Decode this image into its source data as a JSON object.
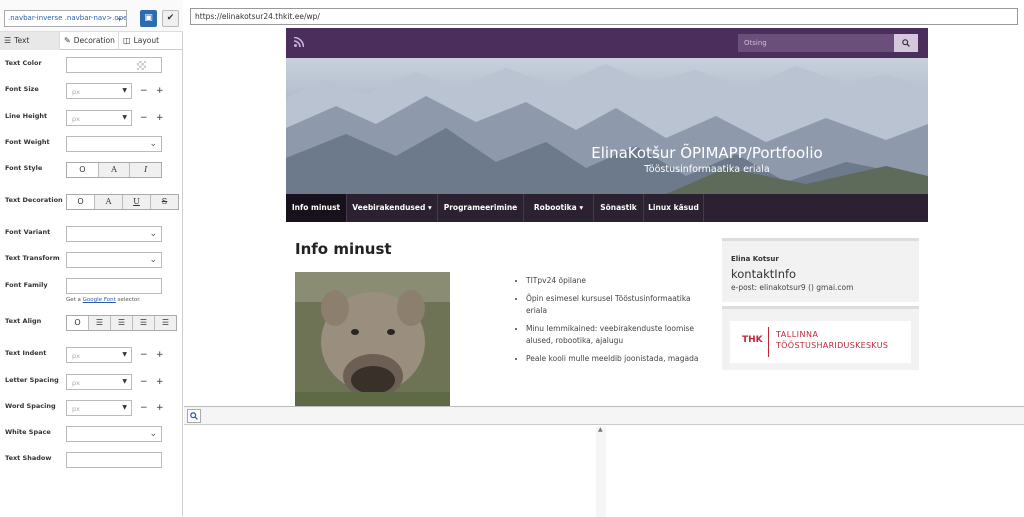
{
  "panel": {
    "selector": ".navbar-inverse .navbar-nav>.ope",
    "tabs": [
      {
        "label": "Text",
        "icon": "text-align-icon"
      },
      {
        "label": "Decoration",
        "icon": "eyedropper-icon"
      },
      {
        "label": "Layout",
        "icon": "layout-icon"
      }
    ],
    "props": {
      "text_color": "Text Color",
      "font_size": "Font Size",
      "line_height": "Line Height",
      "font_weight": "Font Weight",
      "font_style": "Font Style",
      "text_decoration": "Text Decoration",
      "font_variant": "Font Variant",
      "text_transform": "Text Transform",
      "font_family": "Font Family",
      "text_align": "Text Align",
      "text_indent": "Text Indent",
      "letter_spacing": "Letter Spacing",
      "word_spacing": "Word Spacing",
      "white_space": "White Space",
      "text_shadow": "Text Shadow"
    },
    "unit_placeholder": "px",
    "minus": "−",
    "plus": "+",
    "font_family_hint_prefix": "Get a",
    "font_family_hint_link": "Google Font",
    "font_family_hint_suffix": "selector.",
    "font_style_options": [
      "O",
      "A",
      "I"
    ],
    "decoration_options": [
      "O",
      "A",
      "U",
      "S"
    ]
  },
  "browser": {
    "url": "https://elinakotsur24.thkit.ee/wp/"
  },
  "site": {
    "search_placeholder": "Otsing",
    "hero_title": "ElinaKotšur ÕPIMAPP/Portfoolio",
    "hero_subtitle": "Tööstusinformaatika eriala",
    "nav": [
      {
        "label": "Info minust",
        "active": true
      },
      {
        "label": "Veebirakendused ▾",
        "active": false
      },
      {
        "label": "Programeerimine",
        "active": false
      },
      {
        "label": "Robootika ▾",
        "active": false
      },
      {
        "label": "Sõnastik",
        "active": false
      },
      {
        "label": "Linux käsud",
        "active": false
      }
    ],
    "page_title": "Info minust",
    "bullets": [
      "TITpv24 õpilane",
      "Õpin esimesel kursusel Tööstusinformaatika eriala",
      "Minu lemmikained: veebirakenduste loomise alused, robootika, ajalugu",
      "Peale kooli mulle meeldib joonistada, magada"
    ],
    "widget_contact": {
      "name": "Elina Kotsur",
      "title": "kontaktInfo",
      "email": "e-post: elinakotsur9 () gmai.com"
    },
    "widget_logo": {
      "abbr": "THK",
      "line1": "TALLINNA",
      "line2": "TÖÖSTUSHARIDUSKESKUS"
    },
    "colors": {
      "header": "#4b2e5c",
      "nav": "#2b2130",
      "accent": "#2b6cb0",
      "logo": "#c0283a"
    }
  }
}
